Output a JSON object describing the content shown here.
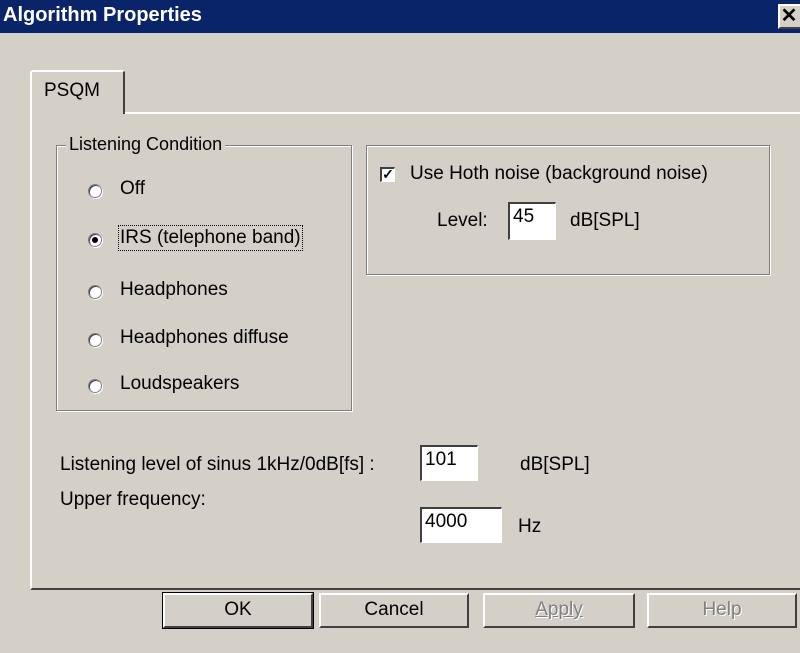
{
  "window": {
    "title": "Algorithm Properties",
    "close_glyph": "✕"
  },
  "tabs": [
    {
      "label": "PSQM",
      "selected": true
    }
  ],
  "listening_condition": {
    "title": "Listening Condition",
    "options": [
      {
        "label": "Off",
        "checked": false
      },
      {
        "label": "IRS (telephone band)",
        "checked": true
      },
      {
        "label": "Headphones",
        "checked": false
      },
      {
        "label": "Headphones diffuse",
        "checked": false
      },
      {
        "label": "Loudspeakers",
        "checked": false
      }
    ]
  },
  "hoth_noise": {
    "checkbox_label": "Use Hoth noise (background noise)",
    "checked": true,
    "level_label": "Level:",
    "level_value": "45",
    "level_unit": "dB[SPL]"
  },
  "listening_level": {
    "label": "Listening level of sinus 1kHz/0dB[fs] :",
    "value": "101",
    "unit": "dB[SPL]"
  },
  "upper_frequency": {
    "label": "Upper frequency:",
    "value": "4000",
    "unit": "Hz"
  },
  "buttons": {
    "ok": "OK",
    "cancel": "Cancel",
    "apply": "Apply",
    "help": "Help"
  }
}
